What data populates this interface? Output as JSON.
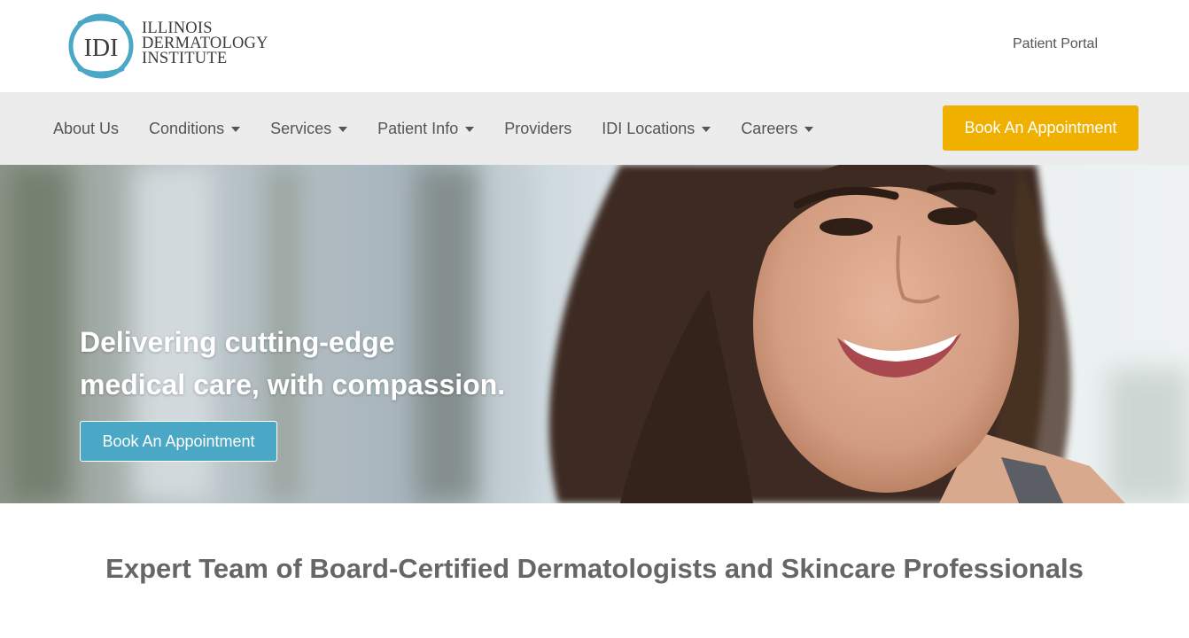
{
  "brand": {
    "logo_letters": "IDI",
    "name_lines": [
      "ILLINOIS",
      "DERMATOLOGY",
      "INSTITUTE"
    ],
    "accent_color": "#4aa8c6"
  },
  "header": {
    "patient_portal": "Patient Portal"
  },
  "nav": {
    "items": [
      {
        "label": "About Us",
        "has_dropdown": false
      },
      {
        "label": "Conditions",
        "has_dropdown": true
      },
      {
        "label": "Services",
        "has_dropdown": true
      },
      {
        "label": "Patient Info",
        "has_dropdown": true
      },
      {
        "label": "Providers",
        "has_dropdown": false
      },
      {
        "label": "IDI Locations",
        "has_dropdown": true
      },
      {
        "label": "Careers",
        "has_dropdown": true
      }
    ],
    "cta": "Book An Appointment",
    "cta_color": "#f0b000"
  },
  "hero": {
    "headline_lines": [
      "Delivering cutting-edge",
      "medical care, with compassion."
    ],
    "button": "Book An Appointment"
  },
  "section": {
    "title": "Expert Team of Board-Certified Dermatologists and Skincare Professionals"
  }
}
